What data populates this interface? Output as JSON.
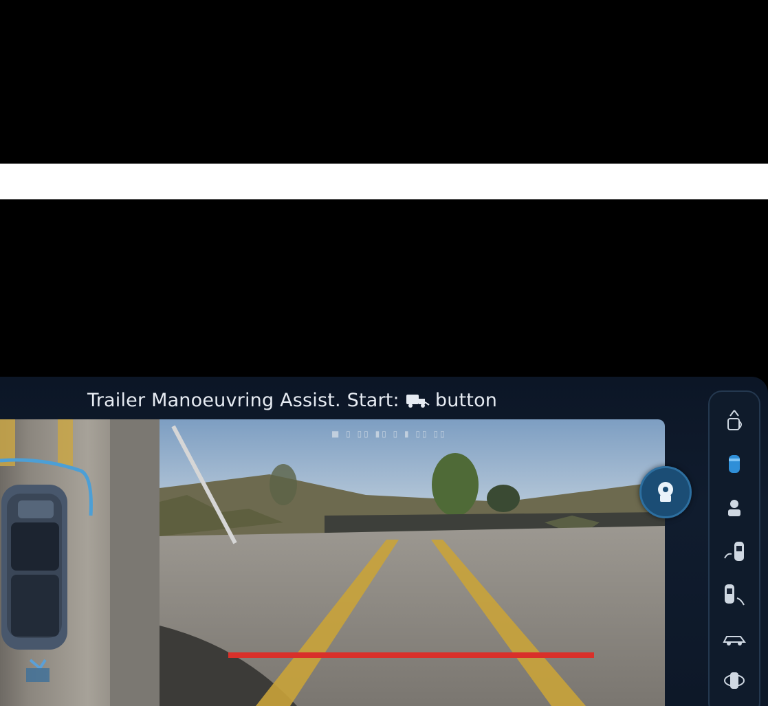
{
  "header": {
    "title_prefix": "Trailer Manoeuvring Assist. Start:",
    "title_suffix": "button",
    "title_icon": "trailer-icon"
  },
  "camera": {
    "caption": "■ ▯ ▯▯ ▮▯ ▯ ▮ ▯▯ ▯▯"
  },
  "colors": {
    "accent_blue": "#2f8fd8",
    "guide_red": "#d9302a",
    "topview_arc": "#4c9fd6"
  },
  "sidebar": {
    "items": [
      {
        "icon": "parking-sensor-icon"
      },
      {
        "icon": "rear-camera-icon",
        "active": true
      },
      {
        "icon": "driver-view-icon"
      },
      {
        "icon": "left-view-icon"
      },
      {
        "icon": "right-view-icon"
      },
      {
        "icon": "side-profile-car-icon"
      },
      {
        "icon": "360-view-icon"
      }
    ]
  },
  "camera_button": {
    "icon": "camera-view-switch-icon"
  }
}
